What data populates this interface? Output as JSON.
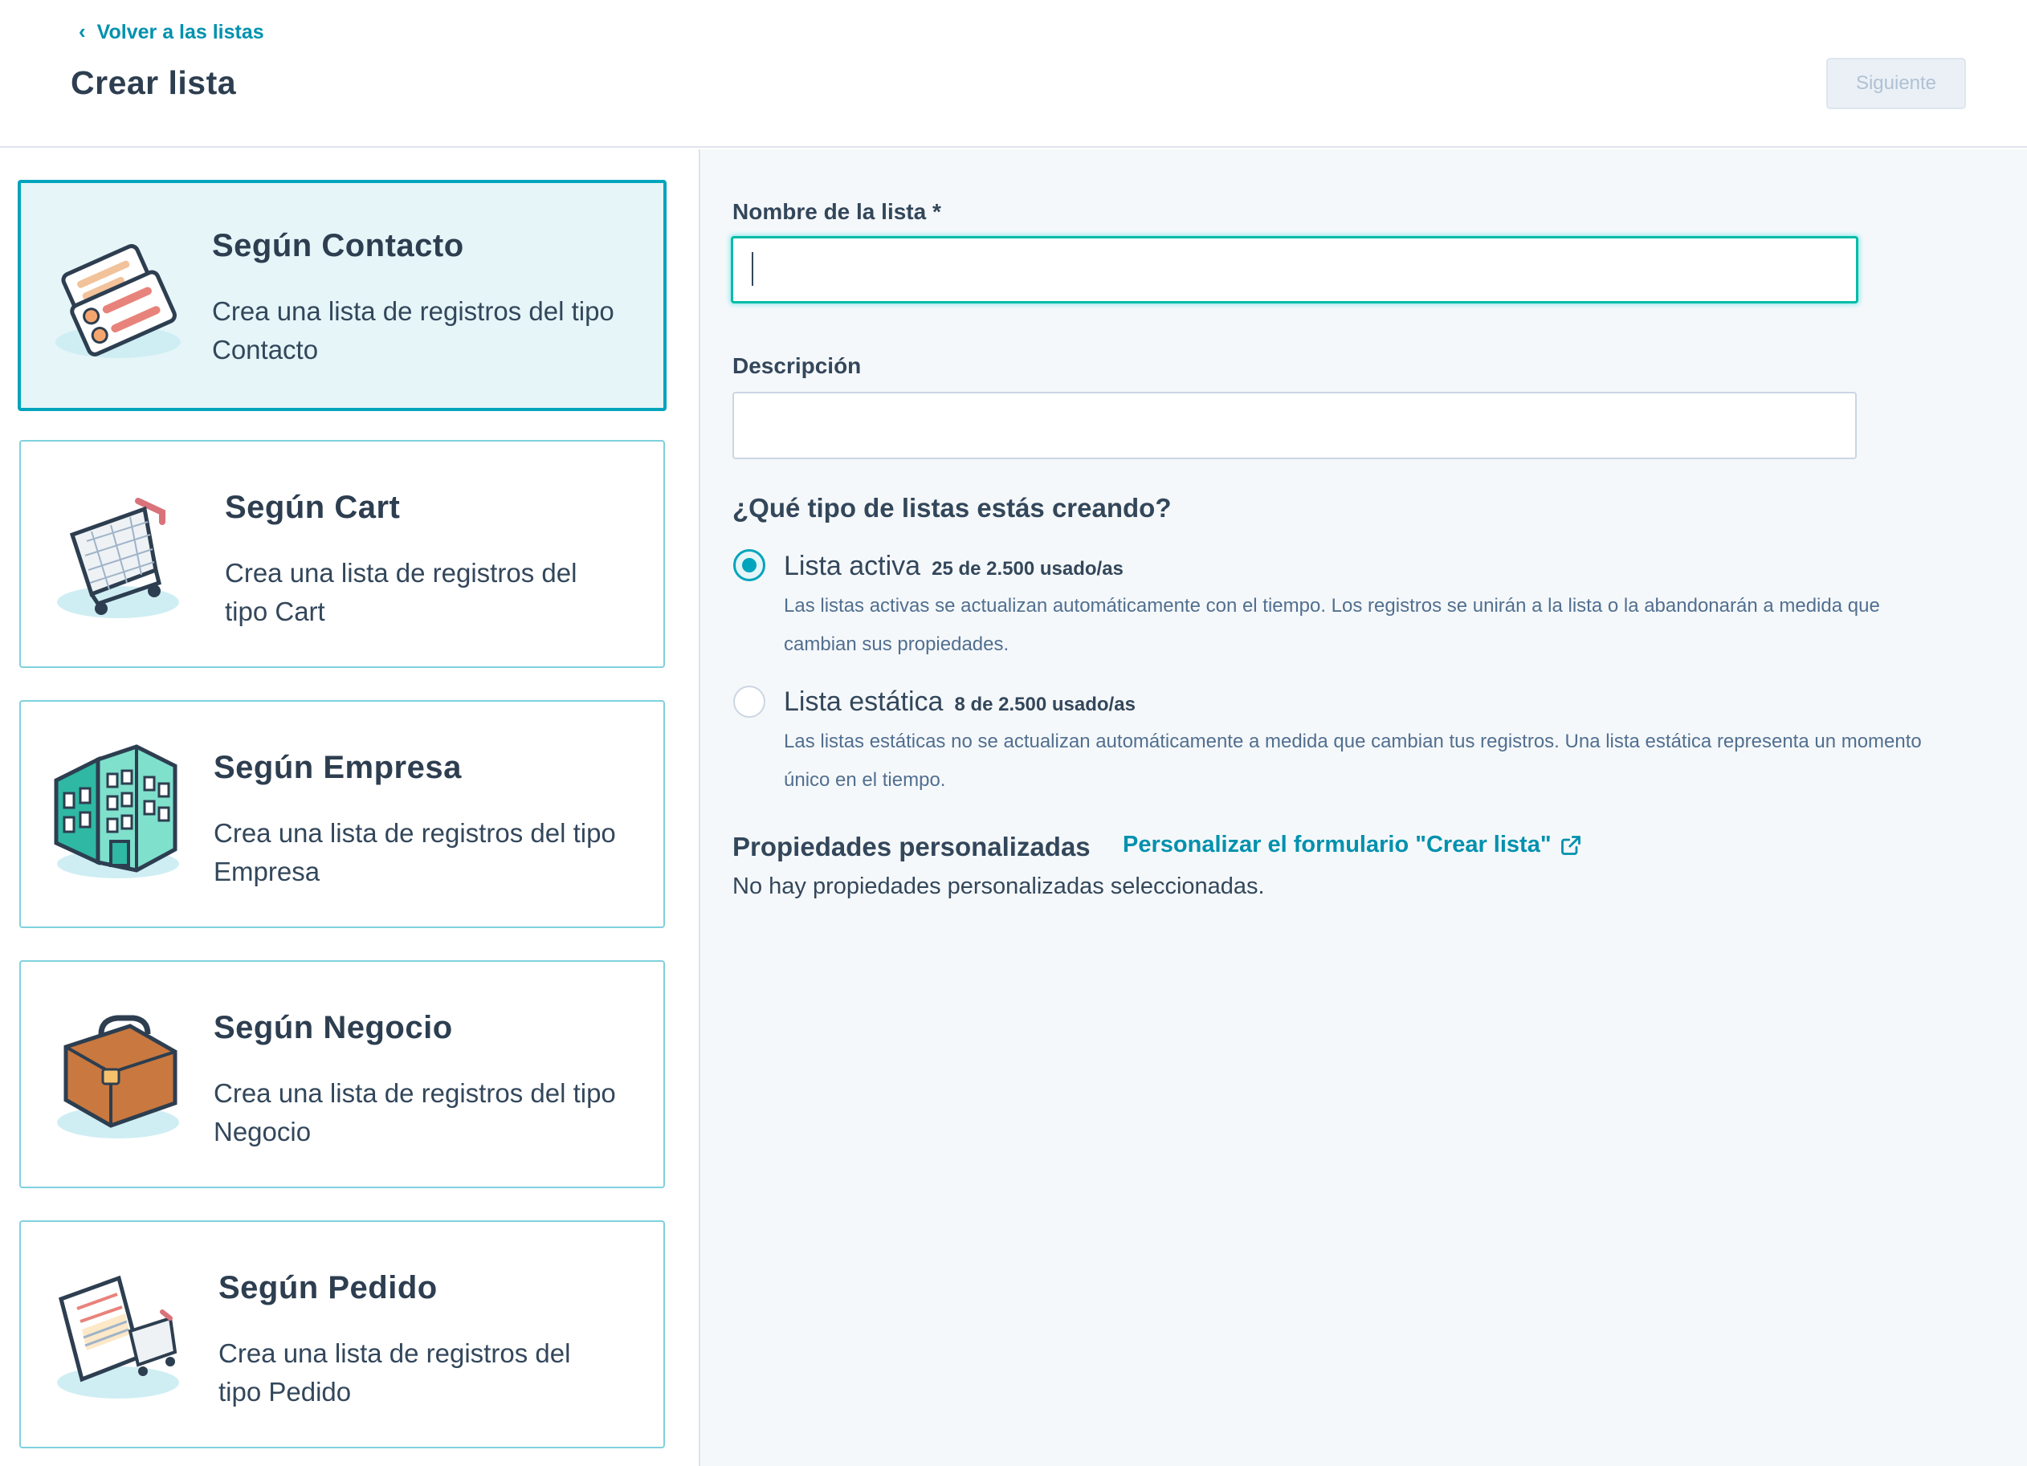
{
  "header": {
    "back_link": "Volver a las listas",
    "title": "Crear lista",
    "next_button": "Siguiente"
  },
  "object_types": [
    {
      "title": "Según Contacto",
      "description": "Crea una lista de registros del tipo Contacto",
      "icon": "contact-cards-icon",
      "selected": true
    },
    {
      "title": "Según Cart",
      "description": "Crea una lista de registros del tipo Cart",
      "icon": "shopping-cart-icon",
      "selected": false
    },
    {
      "title": "Según Empresa",
      "description": "Crea una lista de registros del tipo Empresa",
      "icon": "building-icon",
      "selected": false
    },
    {
      "title": "Según Negocio",
      "description": "Crea una lista de registros del tipo Negocio",
      "icon": "briefcase-icon",
      "selected": false
    },
    {
      "title": "Según Pedido",
      "description": "Crea una lista de registros del tipo Pedido",
      "icon": "order-receipt-icon",
      "selected": false
    }
  ],
  "form": {
    "name_label": "Nombre de la lista *",
    "name_value": "",
    "description_label": "Descripción",
    "description_value": "",
    "list_type_question": "¿Qué tipo de listas estás creando?",
    "options": [
      {
        "title": "Lista activa",
        "usage": "25 de 2.500 usado/as",
        "desc_line1": "Las listas activas se actualizan automáticamente con el tiempo. Los registros se unirán a la lista o la abandonarán a medida que",
        "desc_line2": "cambian sus propiedades.",
        "checked": true
      },
      {
        "title": "Lista estática",
        "usage": "8 de 2.500 usado/as",
        "desc_line1": "Las listas estáticas no se actualizan automáticamente a medida que cambian tus registros. Una lista estática representa un momento",
        "desc_line2": "único en el tiempo.",
        "checked": false
      }
    ],
    "custom_props_title": "Propiedades personalizadas",
    "custom_props_link": "Personalizar el formulario \"Crear lista\"",
    "custom_props_empty": "No hay propiedades personalizadas seleccionadas."
  },
  "colors": {
    "accent": "#00a4bd",
    "link": "#0091ae",
    "text": "#33475b",
    "selected_bg": "#e5f5f8"
  }
}
